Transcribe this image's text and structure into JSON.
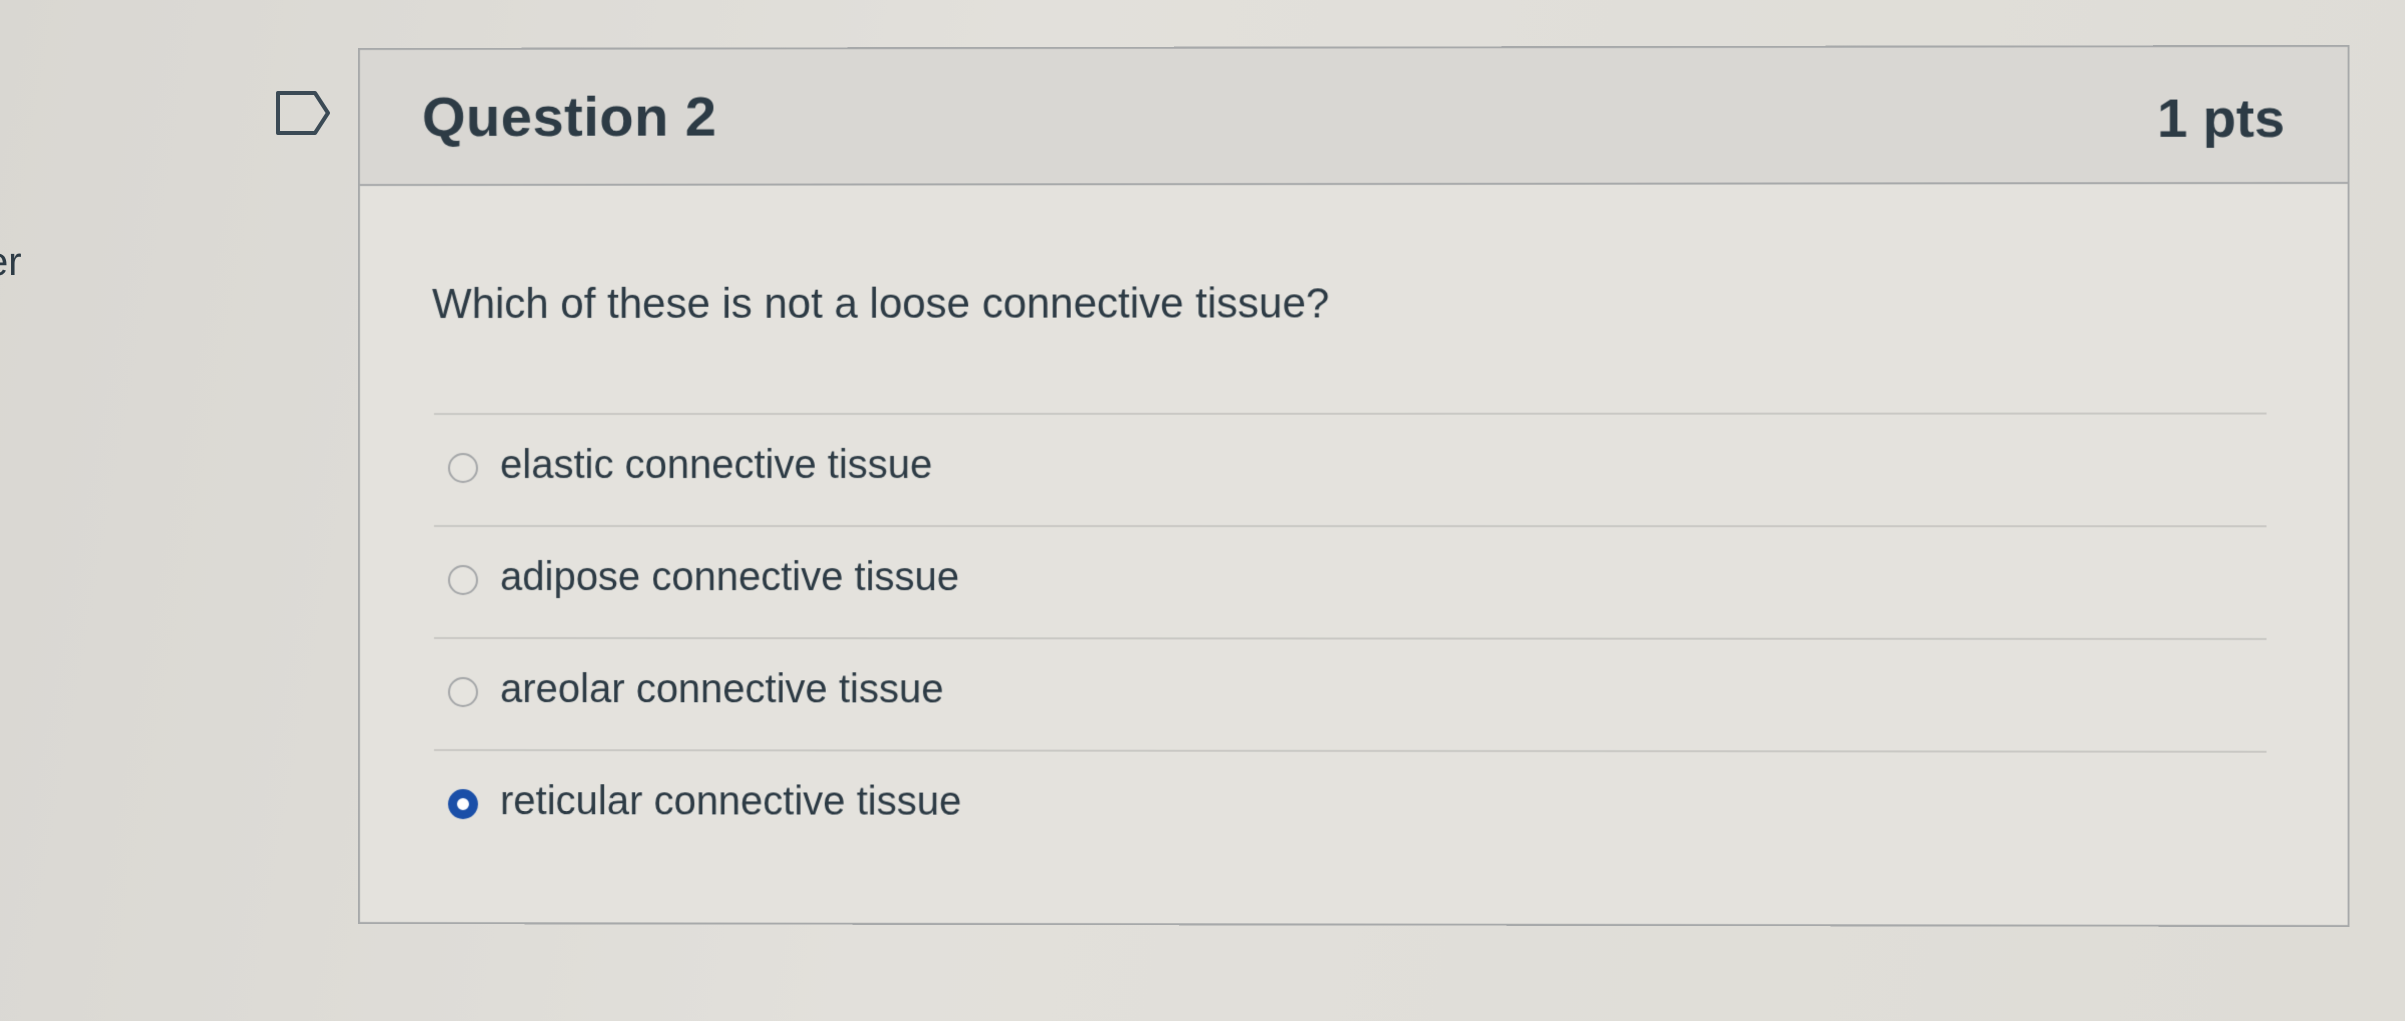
{
  "side_fragment": "er",
  "question": {
    "title": "Question 2",
    "points": "1 pts",
    "text": "Which of these is not a loose connective tissue?",
    "answers": [
      {
        "label": "elastic connective tissue",
        "selected": false
      },
      {
        "label": "adipose connective tissue",
        "selected": false
      },
      {
        "label": "areolar connective tissue",
        "selected": false
      },
      {
        "label": "reticular connective tissue",
        "selected": true
      }
    ]
  },
  "icons": {
    "flag": "flag-bookmark-icon"
  },
  "colors": {
    "selected_radio": "#1a4fa8",
    "text": "#2d3b45",
    "border": "#a7a9aa"
  }
}
